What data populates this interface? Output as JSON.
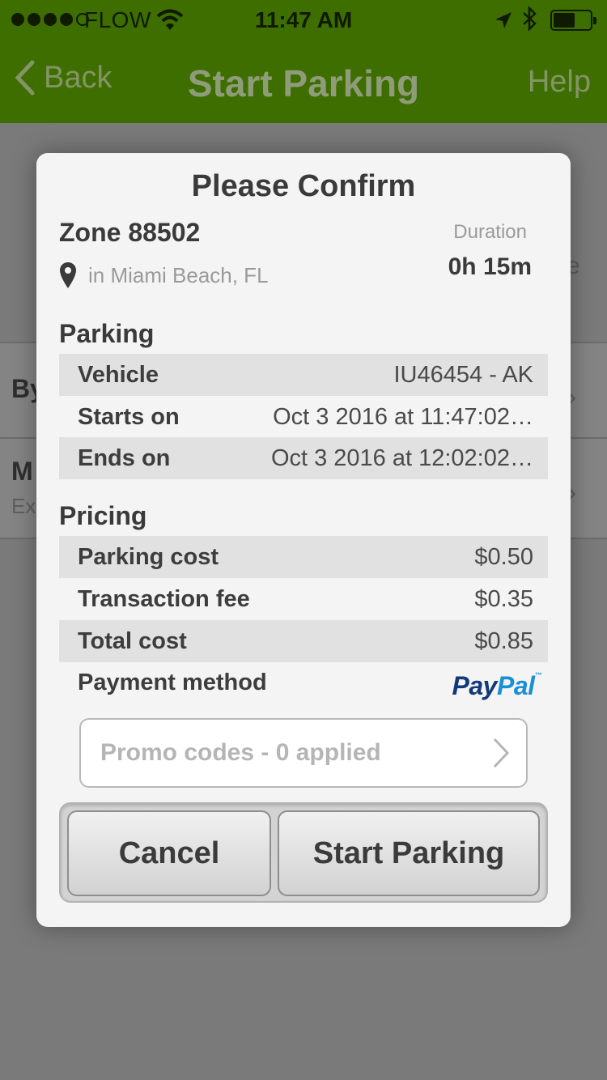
{
  "status_bar": {
    "carrier": "FLOW",
    "time": "11:47 AM"
  },
  "nav": {
    "back_label": "Back",
    "title": "Start Parking",
    "help_label": "Help"
  },
  "background": {
    "row1_label": "By",
    "row2_label": "M",
    "row2_sub": "Ex",
    "right_fragment": "e"
  },
  "modal": {
    "title": "Please Confirm",
    "zone": "Zone 88502",
    "location": "in Miami Beach, FL",
    "duration_label": "Duration",
    "duration_value": "0h 15m",
    "parking_section": "Parking",
    "parking_rows": [
      {
        "label": "Vehicle",
        "value": "IU46454 - AK"
      },
      {
        "label": "Starts on",
        "value": "Oct 3 2016 at 11:47:02…"
      },
      {
        "label": "Ends on",
        "value": "Oct 3 2016 at 12:02:02…"
      }
    ],
    "pricing_section": "Pricing",
    "pricing_rows": [
      {
        "label": "Parking cost",
        "value": "$0.50"
      },
      {
        "label": "Transaction fee",
        "value": "$0.35"
      },
      {
        "label": "Total cost",
        "value": "$0.85"
      }
    ],
    "payment_label": "Payment method",
    "payment_logo_part1": "Pay",
    "payment_logo_part2": "Pal",
    "payment_logo_tm": "™",
    "promo_label": "Promo codes - 0 applied",
    "cancel_label": "Cancel",
    "start_label": "Start Parking"
  },
  "colors": {
    "header_green": "#3f6e00",
    "paypal_dark": "#14397a",
    "paypal_light": "#1a8fd6"
  }
}
